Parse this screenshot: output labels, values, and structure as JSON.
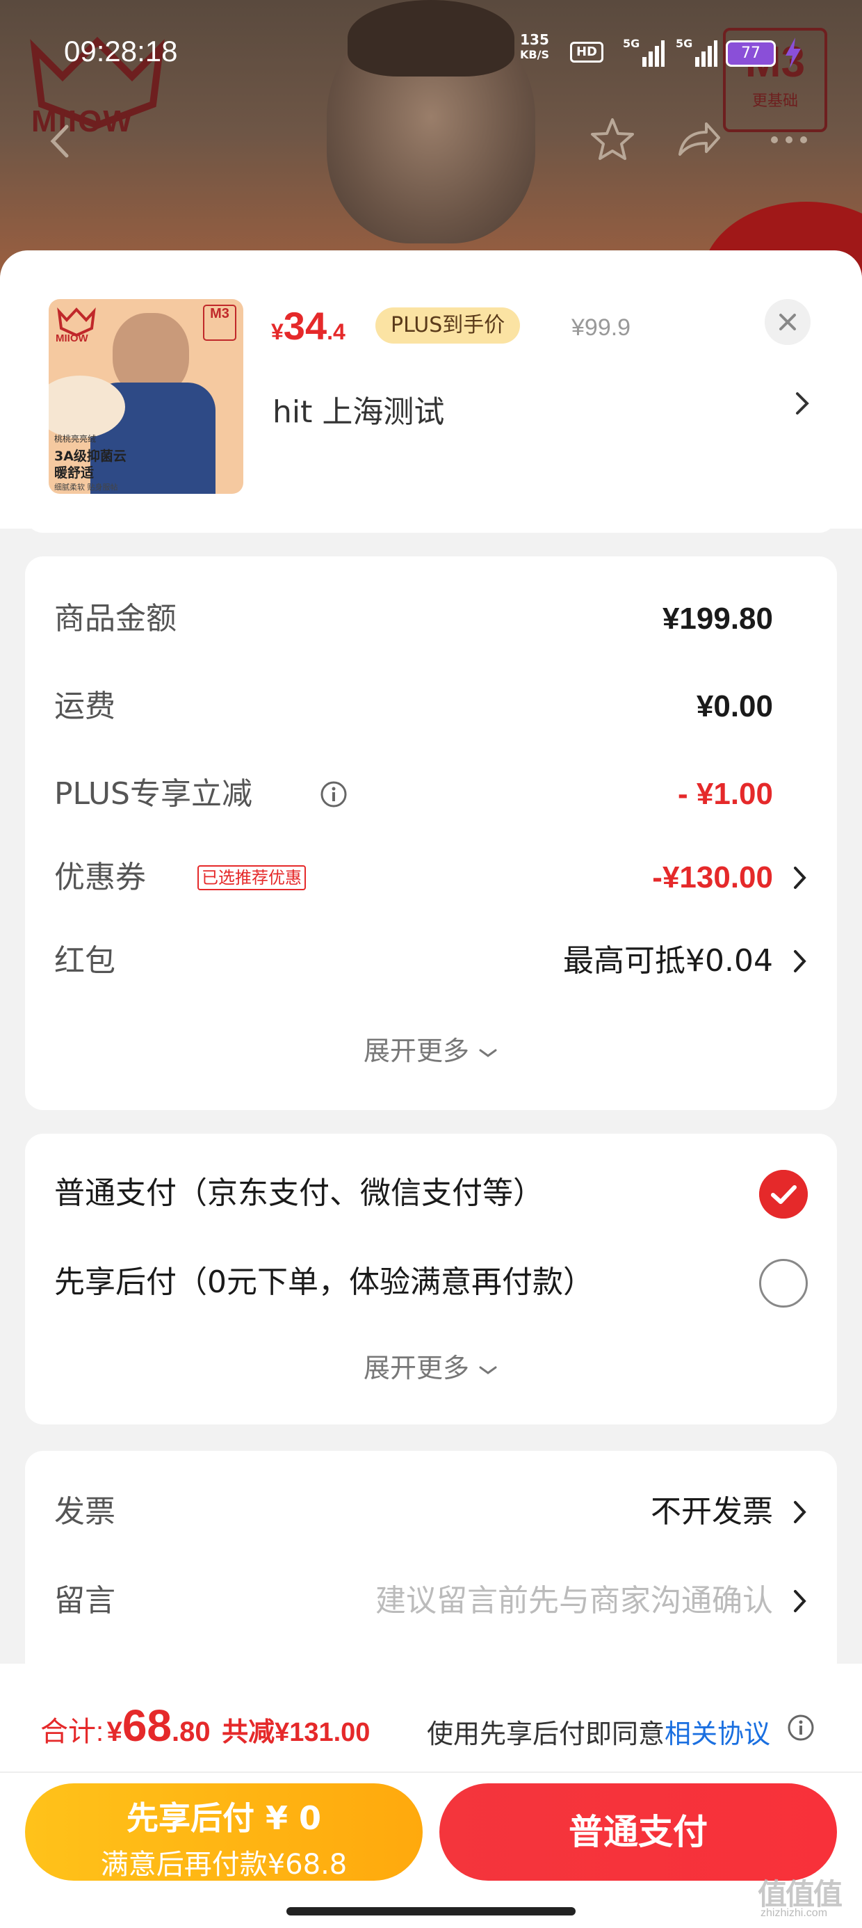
{
  "status_bar": {
    "time": "09:28:18",
    "net_speed_value": "135",
    "net_speed_unit": "KB/S",
    "hd_label": "HD",
    "signal_1": "5G",
    "signal_2": "5G",
    "battery": "77"
  },
  "background": {
    "brand_logo_text": "MIIOW",
    "badge_big": "M3",
    "badge_small": "更基础"
  },
  "product": {
    "thumb_logo_text": "MIIOW",
    "thumb_badge": "M3",
    "thumb_caption_1": "桃桃亮亮绒",
    "thumb_caption_2": "3A级抑菌云暖舒适",
    "thumb_caption_3": "细腻柔软 贴身服帖",
    "price_symbol": "¥",
    "price_int": "34",
    "price_dec": ".4",
    "plus_badge": "PLUS到手价",
    "old_price": "¥99.9",
    "address": "hit  上海测试"
  },
  "amounts": {
    "goods_label": "商品金额",
    "goods_value": "¥199.80",
    "shipping_label": "运费",
    "shipping_value": "¥0.00",
    "plus_label": "PLUS专享立减",
    "plus_value": "- ¥1.00",
    "coupon_label": "优惠券",
    "coupon_tag": "已选推荐优惠",
    "coupon_value": "-¥130.00",
    "redpacket_label": "红包",
    "redpacket_value": "最高可抵¥0.04",
    "expand_label": "展开更多"
  },
  "payment": {
    "option_normal": "普通支付（京东支付、微信支付等）",
    "option_later": "先享后付（0元下单，体验满意再付款）",
    "expand_label": "展开更多",
    "selected": "normal"
  },
  "misc": {
    "invoice_label": "发票",
    "invoice_value": "不开发票",
    "message_label": "留言",
    "message_placeholder": "建议留言前先与商家沟通确认"
  },
  "footer": {
    "total_label": "合计:",
    "total_symbol": "¥",
    "total_int": "68",
    "total_dec": ".80",
    "total_saved": "共减¥131.00",
    "agree_text": "使用先享后付即同意",
    "agree_link": "相关协议",
    "btn_later_line1": "先享后付 ¥ 0",
    "btn_later_line2": "满意后再付款¥68.8",
    "btn_normal": "普通支付"
  },
  "watermark": {
    "text": "值值值",
    "sub": "zhizhizhi.com"
  },
  "colors": {
    "accent_red": "#e5292a",
    "accent_yellow": "#ffb515",
    "link_blue": "#1a6fe0"
  }
}
